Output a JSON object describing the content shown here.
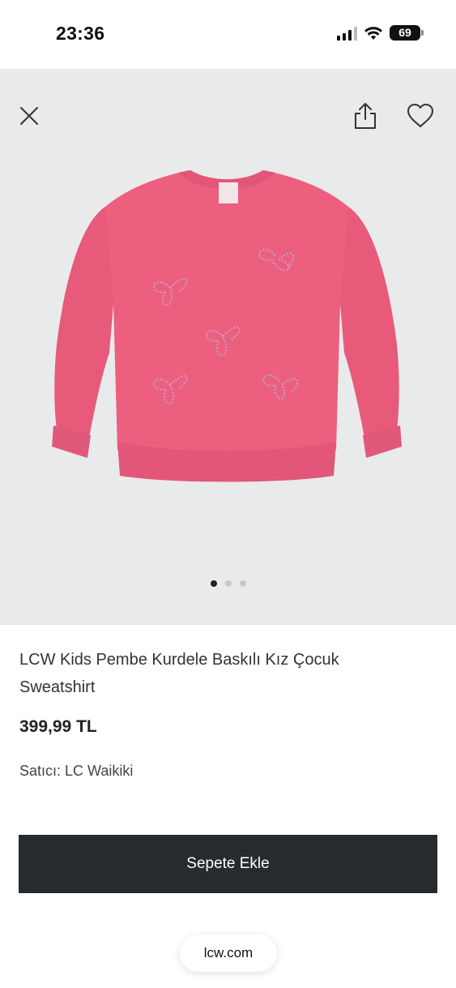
{
  "status_bar": {
    "time": "23:36",
    "battery": "69"
  },
  "gallery": {
    "close_icon": "close-icon",
    "share_icon": "share-icon",
    "favorite_icon": "heart-icon",
    "image_count": 3,
    "active_index": 0,
    "product_color": "#ec5f7e"
  },
  "product": {
    "title": "LCW Kids Pembe Kurdele Baskılı Kız Çocuk Sweatshirt",
    "price": "399,99 TL",
    "seller": "Satıcı: LC Waikiki"
  },
  "actions": {
    "add_to_cart": "Sepete Ekle"
  },
  "browser": {
    "url": "lcw.com"
  }
}
